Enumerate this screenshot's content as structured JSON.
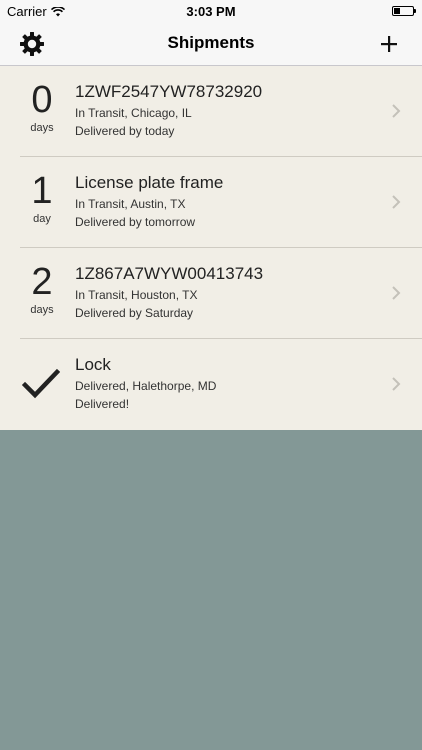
{
  "status_bar": {
    "carrier": "Carrier",
    "time": "3:03 PM"
  },
  "nav": {
    "title": "Shipments",
    "left_icon": "gear-icon",
    "right_icon": "plus-icon"
  },
  "colors": {
    "list_background": "#f1eee6",
    "page_background": "#839896",
    "nav_background": "#f7f7f7"
  },
  "shipments": [
    {
      "days": "0",
      "days_unit": "days",
      "title": "1ZWF2547YW78732920",
      "status": "In Transit, Chicago, IL",
      "eta": "Delivered by today"
    },
    {
      "days": "1",
      "days_unit": "day",
      "title": "License plate frame",
      "status": "In Transit, Austin, TX",
      "eta": "Delivered by tomorrow"
    },
    {
      "days": "2",
      "days_unit": "days",
      "title": "1Z867A7WYW00413743",
      "status": "In Transit, Houston, TX",
      "eta": "Delivered by Saturday"
    },
    {
      "icon": "checkmark-icon",
      "title": "Lock",
      "status": "Delivered, Halethorpe, MD",
      "eta": "Delivered!"
    }
  ]
}
